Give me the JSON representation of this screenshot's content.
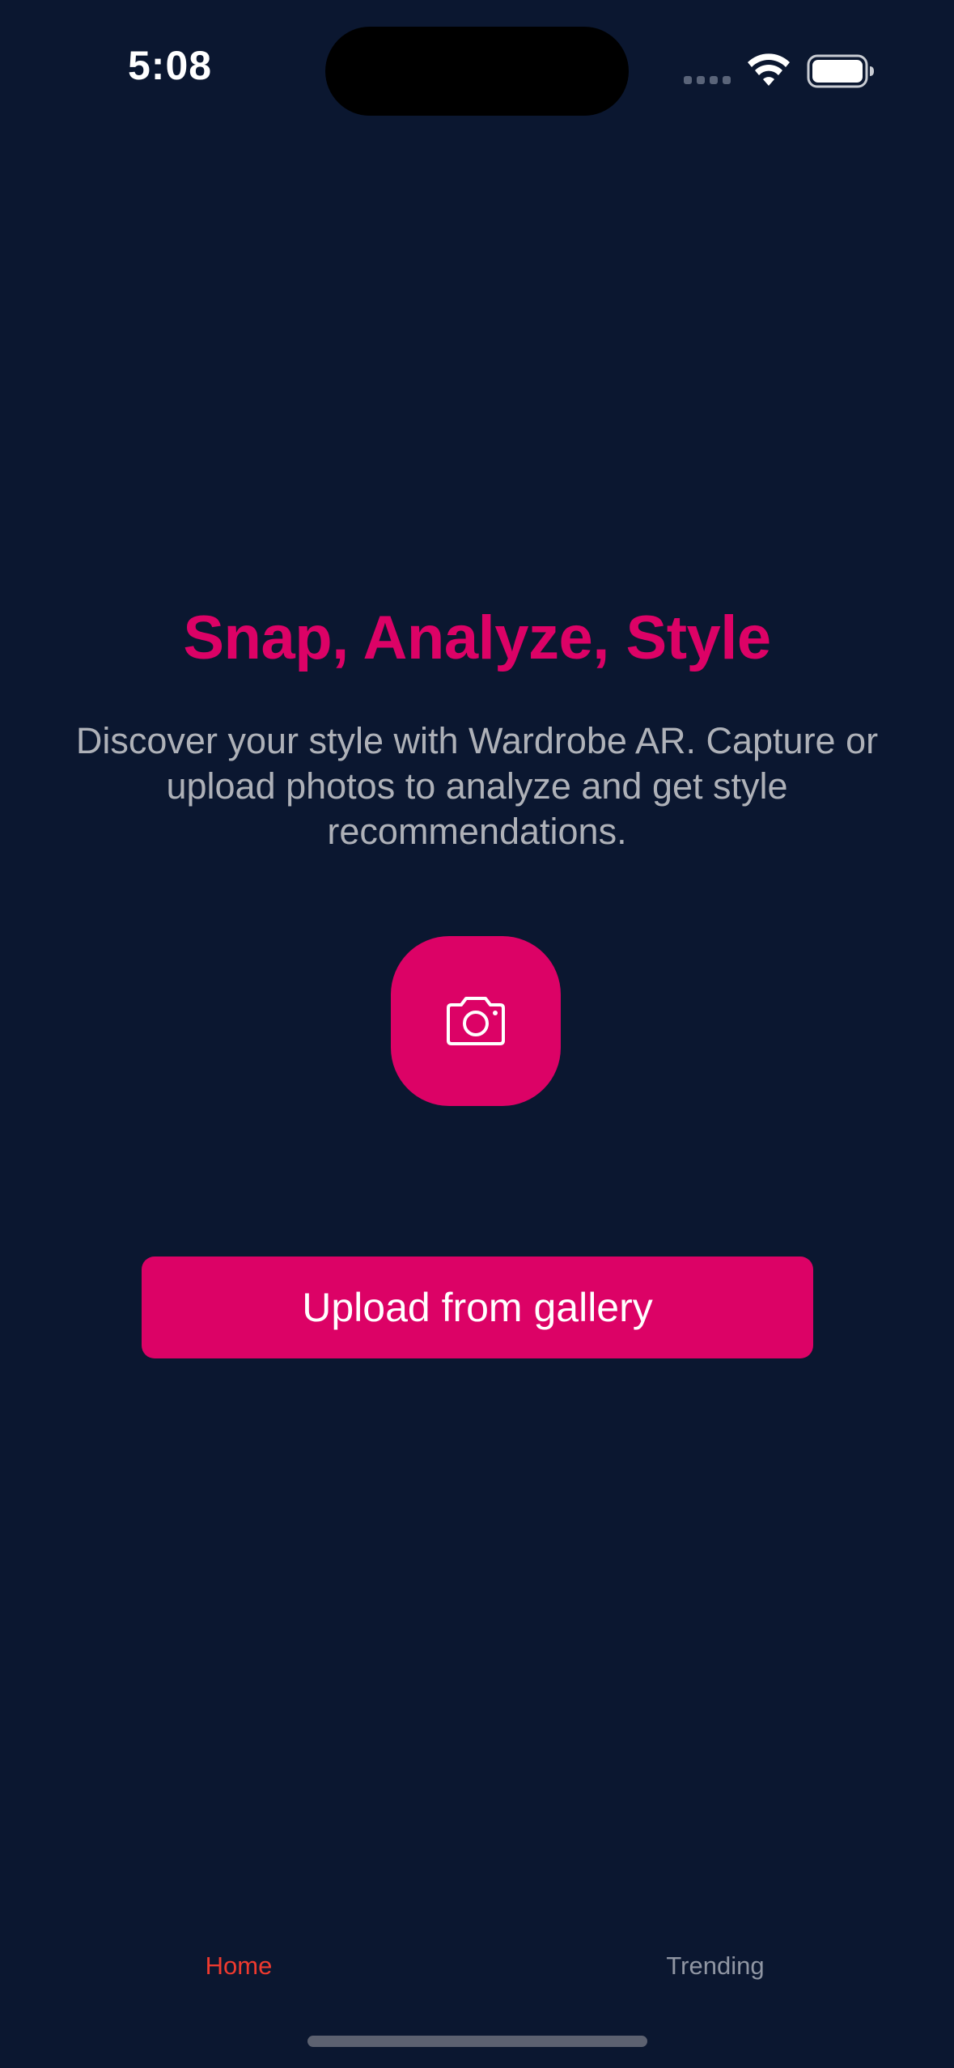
{
  "status_bar": {
    "time": "5:08"
  },
  "hero": {
    "title": "Snap, Analyze, Style",
    "description": "Discover your style with Wardrobe AR. Capture or upload photos to analyze and get style recommendations."
  },
  "actions": {
    "camera_icon": "camera-icon",
    "upload_label": "Upload from gallery"
  },
  "tab_bar": {
    "tabs": [
      {
        "label": "Home",
        "active": true
      },
      {
        "label": "Trending",
        "active": false
      }
    ]
  },
  "colors": {
    "background": "#0b1730",
    "accent": "#dc0266",
    "active_tab": "#ee3a2f",
    "inactive_tab": "#9096a3",
    "body_text": "#aeb1b8"
  }
}
